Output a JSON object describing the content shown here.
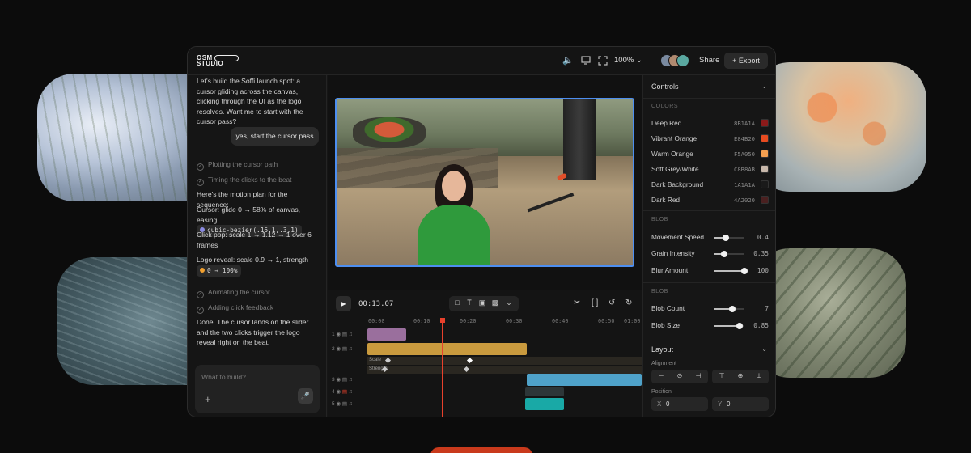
{
  "app": {
    "logo_line1": "OSM",
    "logo_line2": "STUDIO",
    "zoom": "100%",
    "share_label": "Share",
    "export_label": "Export"
  },
  "chat": {
    "intro": "Let's build the Soffi launch spot: a cursor gliding across the canvas, clicking through the UI as the logo resolves. Want me to start with the cursor pass?",
    "user_reply": "yes, start the cursor pass",
    "steps_a": [
      "Plotting the cursor path",
      "Timing the clicks to the beat"
    ],
    "plan_heading": "Here's the motion plan for the sequence:",
    "cursor_line": "Cursor: glide 0 → 58% of canvas, easing",
    "cursor_chip": "cubic-bezier(.16,1,.3,1)",
    "click_line": "Click pop: scale 1 → 1.12 → 1 over 6 frames",
    "logo_line": "Logo reveal: scale 0.9 → 1, strength",
    "logo_chip": "0 → 100%",
    "steps_b": [
      "Animating the cursor",
      "Adding click feedback"
    ],
    "done": "Done. The cursor lands on the slider and the two clicks trigger the logo reveal right on the beat.",
    "composer_placeholder": "What to build?"
  },
  "timeline": {
    "timecode": "00:13.07",
    "ruler": [
      "00:00",
      "00:10",
      "00:20",
      "00:30",
      "00:40",
      "00:50",
      "01:00"
    ],
    "tracks": [
      "1",
      "2",
      "3",
      "4",
      "5"
    ],
    "sub_tracks": [
      "Scale",
      "Strength"
    ]
  },
  "controls": {
    "title": "Controls",
    "colors_heading": "COLORS",
    "colors": [
      {
        "name": "Deep Red",
        "hex": "8B1A1A",
        "color": "#8B1A1A"
      },
      {
        "name": "Vibrant Orange",
        "hex": "E84B20",
        "color": "#E84B20"
      },
      {
        "name": "Warm Orange",
        "hex": "F5A050",
        "color": "#F5A050"
      },
      {
        "name": "Soft Grey/White",
        "hex": "C8B8AB",
        "color": "#C8B8AB"
      },
      {
        "name": "Dark Background",
        "hex": "1A1A1A",
        "color": "#1A1A1A"
      },
      {
        "name": "Dark Red",
        "hex": "4A2020",
        "color": "#4A2020"
      }
    ],
    "blob1_heading": "BLOB",
    "blob1": [
      {
        "name": "Movement Speed",
        "value": "0.4",
        "level": 0.4
      },
      {
        "name": "Grain Intensity",
        "value": "0.35",
        "level": 0.35
      },
      {
        "name": "Blur Amount",
        "value": "100",
        "level": 1.0
      }
    ],
    "blob2_heading": "BLOB",
    "blob2": [
      {
        "name": "Blob Count",
        "value": "7",
        "level": 0.6
      },
      {
        "name": "Blob Size",
        "value": "0.85",
        "level": 0.85
      }
    ],
    "layout_title": "Layout",
    "alignment_label": "Alignment",
    "position_label": "Position",
    "pos_x_label": "X",
    "pos_x": "0",
    "pos_y_label": "Y",
    "pos_y": "0"
  }
}
